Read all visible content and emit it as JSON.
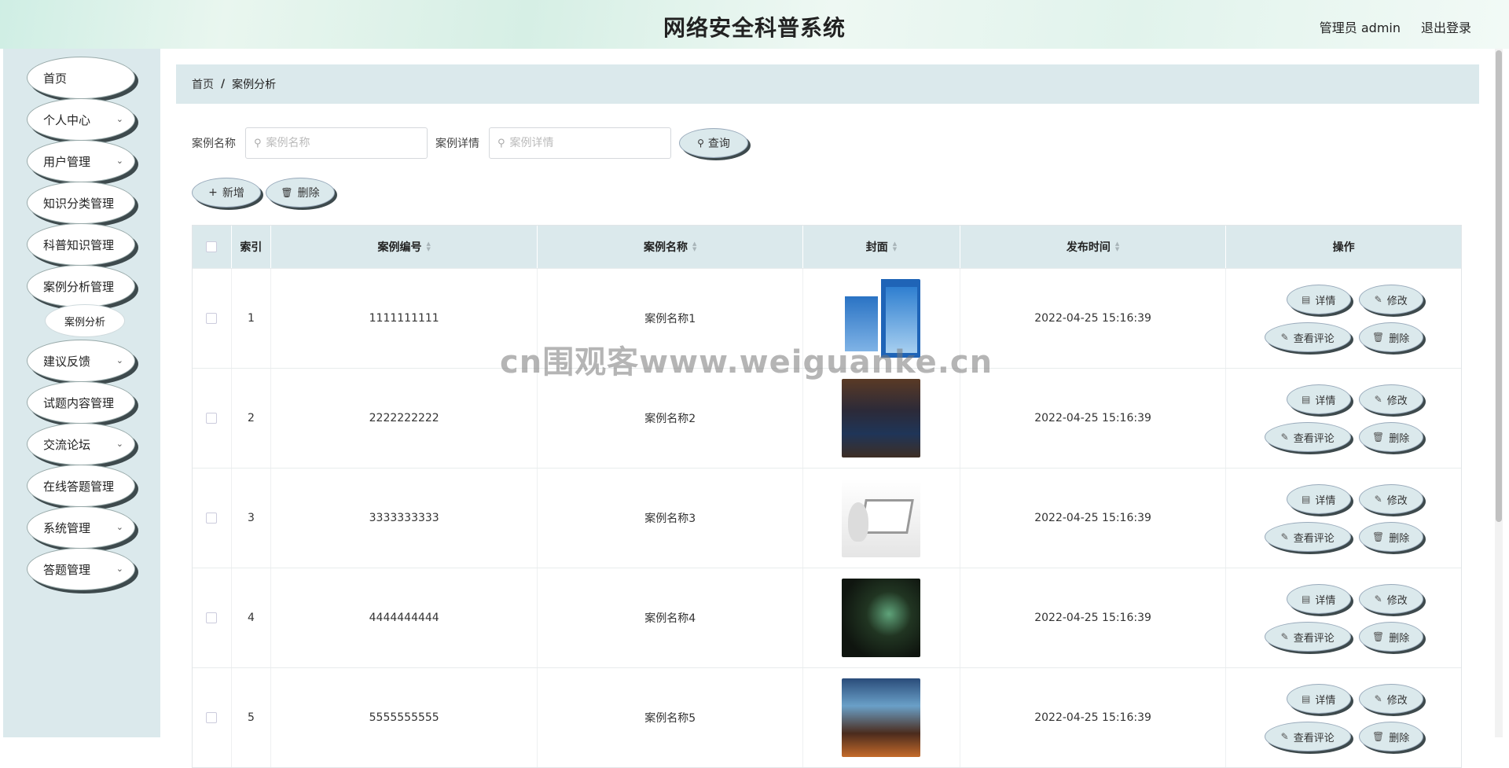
{
  "header": {
    "title": "网络安全科普系统",
    "user": "管理员 admin",
    "logout": "退出登录"
  },
  "sidebar": {
    "items": [
      {
        "label": "首页",
        "has_chevron": false
      },
      {
        "label": "个人中心",
        "has_chevron": true
      },
      {
        "label": "用户管理",
        "has_chevron": true
      },
      {
        "label": "知识分类管理",
        "has_chevron": false
      },
      {
        "label": "科普知识管理",
        "has_chevron": false
      },
      {
        "label": "案例分析管理",
        "has_chevron": false
      },
      {
        "label": "建议反馈",
        "has_chevron": true
      },
      {
        "label": "试题内容管理",
        "has_chevron": false
      },
      {
        "label": "交流论坛",
        "has_chevron": true
      },
      {
        "label": "在线答题管理",
        "has_chevron": false
      },
      {
        "label": "系统管理",
        "has_chevron": true
      },
      {
        "label": "答题管理",
        "has_chevron": true
      }
    ],
    "sub_item": "案例分析"
  },
  "breadcrumb": {
    "home": "首页",
    "separator": "/",
    "current": "案例分析"
  },
  "search": {
    "name_label": "案例名称",
    "name_placeholder": "案例名称",
    "detail_label": "案例详情",
    "detail_placeholder": "案例详情",
    "query_button": "查询"
  },
  "actions": {
    "add": "新增",
    "delete": "删除"
  },
  "table": {
    "columns": {
      "index": "索引",
      "code": "案例编号",
      "name": "案例名称",
      "cover": "封面",
      "time": "发布时间",
      "ops": "操作"
    },
    "op_labels": {
      "detail": "详情",
      "edit": "修改",
      "review": "查看评论",
      "delete": "删除"
    },
    "rows": [
      {
        "index": "1",
        "code": "1111111111",
        "name": "案例名称1",
        "time": "2022-04-25 15:16:39"
      },
      {
        "index": "2",
        "code": "2222222222",
        "name": "案例名称2",
        "time": "2022-04-25 15:16:39"
      },
      {
        "index": "3",
        "code": "3333333333",
        "name": "案例名称3",
        "time": "2022-04-25 15:16:39"
      },
      {
        "index": "4",
        "code": "4444444444",
        "name": "案例名称4",
        "time": "2022-04-25 15:16:39"
      },
      {
        "index": "5",
        "code": "5555555555",
        "name": "案例名称5",
        "time": "2022-04-25 15:16:39"
      }
    ]
  },
  "watermark": "cn围观客www.weiguanke.cn",
  "colors": {
    "accent": "#dbe9ec",
    "shadow": "#3e4a4d"
  }
}
